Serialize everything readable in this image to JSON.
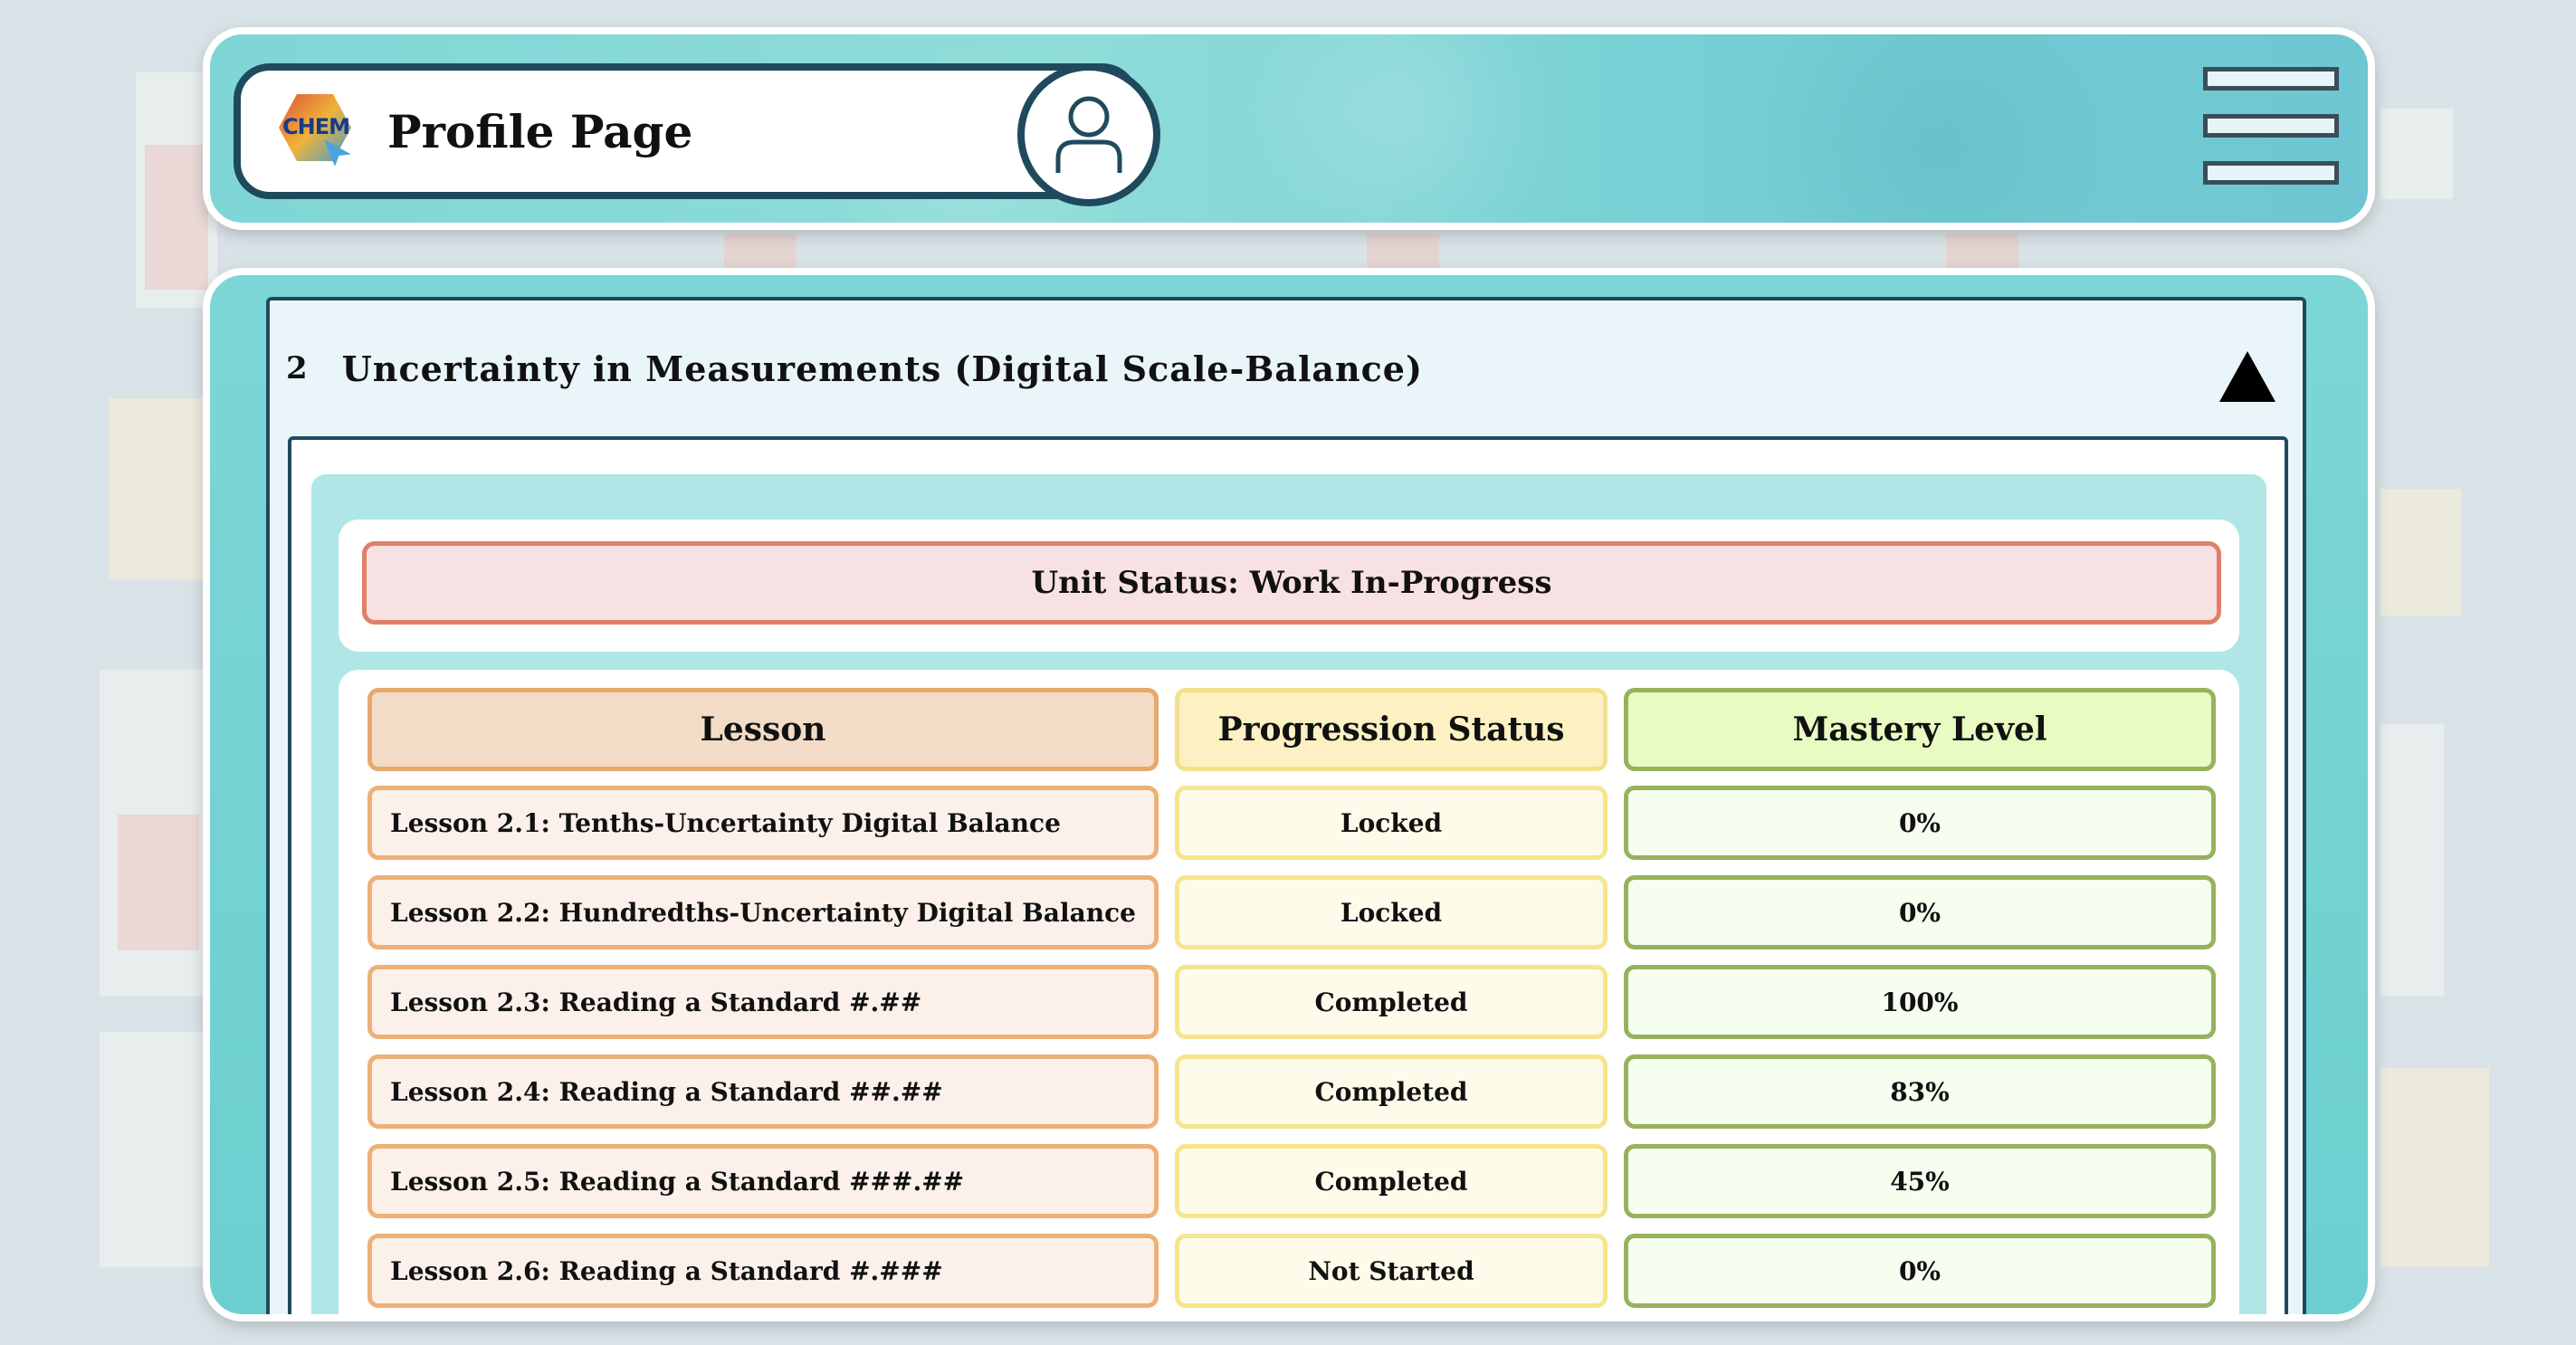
{
  "header": {
    "title": "Profile Page",
    "logo_icon": "chem-logo-icon",
    "avatar_icon": "user-icon",
    "menu_icon": "hamburger-menu-icon"
  },
  "unit": {
    "number": "2",
    "title": "Uncertainty in Measurements (Digital Scale-Balance)",
    "toggle_icon": "collapse-triangle-icon",
    "status": "Unit Status: Work In-Progress"
  },
  "table": {
    "headers": [
      "Lesson",
      "Progression Status",
      "Mastery Level"
    ],
    "rows": [
      {
        "lesson": "Lesson 2.1: Tenths-Uncertainty Digital Balance",
        "status": "Locked",
        "mastery": "0%"
      },
      {
        "lesson": "Lesson 2.2: Hundredths-Uncertainty Digital Balance",
        "status": "Locked",
        "mastery": "0%"
      },
      {
        "lesson": "Lesson 2.3: Reading a Standard #.##",
        "status": "Completed",
        "mastery": "100%"
      },
      {
        "lesson": "Lesson 2.4: Reading a Standard ##.##",
        "status": "Completed",
        "mastery": "83%"
      },
      {
        "lesson": "Lesson 2.5: Reading a Standard ###.##",
        "status": "Completed",
        "mastery": "45%"
      },
      {
        "lesson": "Lesson 2.6: Reading a Standard #.###",
        "status": "Not Started",
        "mastery": "0%"
      }
    ]
  },
  "colors": {
    "accent_dark": "#1f4a5e",
    "teal": "#7dd6d6",
    "status_border": "#e07f6a"
  }
}
